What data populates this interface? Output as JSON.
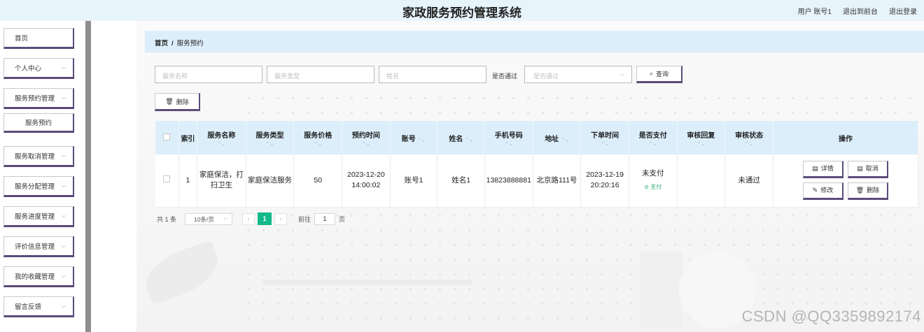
{
  "header": {
    "title": "家政服务预约管理系统",
    "user_label": "用户 账号1",
    "back_to_front": "退出到前台",
    "logout": "退出登录"
  },
  "sidebar": {
    "items": [
      {
        "label": "首页",
        "has_chevron": false
      },
      {
        "label": "个人中心",
        "has_chevron": true
      },
      {
        "label": "服务预约管理",
        "has_chevron": true
      },
      {
        "label": "服务预约",
        "has_chevron": false,
        "sub": true
      },
      {
        "label": "服务取消管理",
        "has_chevron": true
      },
      {
        "label": "服务分配管理",
        "has_chevron": true
      },
      {
        "label": "服务进度管理",
        "has_chevron": true
      },
      {
        "label": "评价信息管理",
        "has_chevron": true
      },
      {
        "label": "我的收藏管理",
        "has_chevron": true
      },
      {
        "label": "留言反馈",
        "has_chevron": true
      }
    ]
  },
  "breadcrumb": {
    "home": "首页",
    "separator": "/",
    "current": "服务预约"
  },
  "search": {
    "service_name_placeholder": "服务名称",
    "service_type_placeholder": "服务类型",
    "name_placeholder": "姓名",
    "paid_label": "是否通过",
    "paid_placeholder": "是否通过",
    "query_button": "查询"
  },
  "toolbar": {
    "delete_button": "删除"
  },
  "table": {
    "headers": [
      "索引",
      "服务名称",
      "服务类型",
      "服务价格",
      "预约时间",
      "账号",
      "姓名",
      "手机号码",
      "地址",
      "下单时间",
      "是否支付",
      "审核回复",
      "审核状态",
      "操作"
    ],
    "rows": [
      {
        "index": "1",
        "service_name": "家庭保洁，打扫卫生",
        "service_type": "家庭保洁服务",
        "price": "50",
        "reserve_time": "2023-12-20 14:00:02",
        "account": "账号1",
        "name": "姓名1",
        "phone": "13823888881",
        "address": "北京路111号",
        "order_time": "2023-12-19 20:20:16",
        "paid": "未支付",
        "pay_link": "支付",
        "review_reply": "",
        "review_status": "未通过",
        "ops": {
          "detail": "详情",
          "cancel": "取消",
          "edit": "修改",
          "delete": "删除"
        }
      }
    ]
  },
  "pagination": {
    "total": "共 1 条",
    "page_size": "10条/页",
    "current_page": "1",
    "goto_label": "前往",
    "goto_value": "1",
    "page_suffix": "页"
  },
  "watermark": "CSDN @QQ3359892174",
  "colors": {
    "header_bg": "#e8f4fb",
    "breadcrumb_bg": "#dceefa",
    "button_border": "#5b4b7a",
    "pager_active": "#13b98a",
    "pay_link": "#35b07a"
  }
}
